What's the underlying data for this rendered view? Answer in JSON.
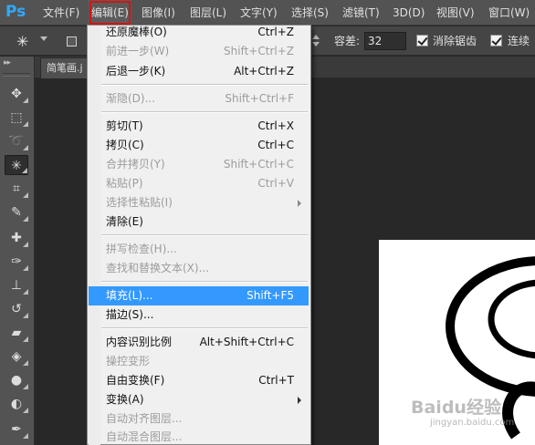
{
  "app": {
    "logo": "Ps"
  },
  "menubar": {
    "file": "文件(F)",
    "edit": "编辑(E)",
    "image": "图像(I)",
    "layer": "图层(L)",
    "type": "文字(Y)",
    "select": "选择(S)",
    "filter": "滤镜(T)",
    "three_d": "3D(D)",
    "view": "视图(V)",
    "window": "窗口(W)"
  },
  "options_bar": {
    "tolerance_label": "容差:",
    "tolerance_value": "32",
    "antialias_label": "消除锯齿",
    "contiguous_label": "连续"
  },
  "document_tab": {
    "title": "简笔画.j"
  },
  "edit_menu": {
    "undo": {
      "label": "还原魔棒(O)",
      "shortcut": "Ctrl+Z"
    },
    "step_forward": {
      "label": "前进一步(W)",
      "shortcut": "Shift+Ctrl+Z"
    },
    "step_backward": {
      "label": "后退一步(K)",
      "shortcut": "Alt+Ctrl+Z"
    },
    "fade": {
      "label": "渐隐(D)...",
      "shortcut": "Shift+Ctrl+F"
    },
    "cut": {
      "label": "剪切(T)",
      "shortcut": "Ctrl+X"
    },
    "copy": {
      "label": "拷贝(C)",
      "shortcut": "Ctrl+C"
    },
    "copy_merged": {
      "label": "合并拷贝(Y)",
      "shortcut": "Shift+Ctrl+C"
    },
    "paste": {
      "label": "粘贴(P)",
      "shortcut": "Ctrl+V"
    },
    "paste_special": {
      "label": "选择性粘贴(I)"
    },
    "clear": {
      "label": "清除(E)"
    },
    "check_spelling": {
      "label": "拼写检查(H)..."
    },
    "find_replace": {
      "label": "查找和替换文本(X)..."
    },
    "fill": {
      "label": "填充(L)...",
      "shortcut": "Shift+F5"
    },
    "stroke": {
      "label": "描边(S)..."
    },
    "content_aware_scale": {
      "label": "内容识别比例",
      "shortcut": "Alt+Shift+Ctrl+C"
    },
    "puppet_warp": {
      "label": "操控变形"
    },
    "free_transform": {
      "label": "自由变换(F)",
      "shortcut": "Ctrl+T"
    },
    "transform": {
      "label": "变换(A)"
    },
    "auto_align": {
      "label": "自动对齐图层..."
    },
    "auto_blend": {
      "label": "自动混合图层..."
    }
  },
  "watermark": {
    "brand": "Baidu经验",
    "url": "jingyan.baidu.com"
  },
  "colors": {
    "highlight": "#3399ff",
    "active_menu_outline": "#d21414",
    "ps_logo": "#31a8ff"
  }
}
